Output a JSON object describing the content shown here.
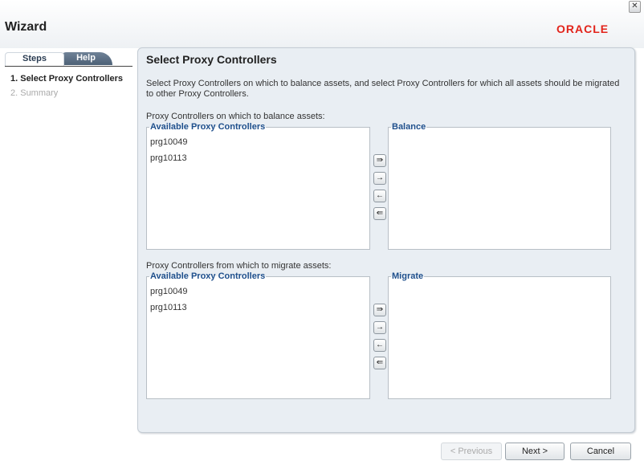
{
  "window": {
    "title": "Wizard",
    "close_glyph": "✕",
    "logo": "ORACLE"
  },
  "tabs": {
    "steps": "Steps",
    "help": "Help"
  },
  "steps": [
    "1. Select Proxy Controllers",
    "2. Summary"
  ],
  "panel": {
    "title": "Select Proxy Controllers",
    "description": "Select Proxy Controllers on which to balance assets, and select Proxy Controllers for which all assets should be migrated to other Proxy Controllers."
  },
  "balance_section": {
    "label": "Proxy Controllers on which to balance assets:",
    "available_title": "Available Proxy Controllers",
    "available_items": [
      "prg10049",
      "prg10113"
    ],
    "selected_title": "Balance"
  },
  "migrate_section": {
    "label": "Proxy Controllers from which to migrate assets:",
    "available_title": "Available Proxy Controllers",
    "available_items": [
      "prg10049",
      "prg10113"
    ],
    "selected_title": "Migrate"
  },
  "arrows": {
    "move_all_right": "⇛",
    "move_right": "→",
    "move_left": "←",
    "move_all_left": "⇚"
  },
  "buttons": {
    "previous": "< Previous",
    "next": "Next >",
    "cancel": "Cancel"
  },
  "colors": {
    "accent": "#1e4f8c",
    "logo": "#e2231a",
    "panel_bg": "#e9eef3"
  }
}
